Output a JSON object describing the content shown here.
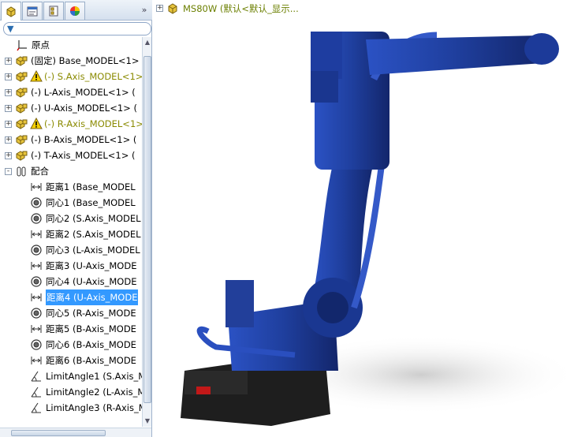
{
  "tabs": [
    {
      "name": "feature-manager-icon"
    },
    {
      "name": "property-manager-icon"
    },
    {
      "name": "configuration-manager-icon"
    },
    {
      "name": "display-manager-icon"
    }
  ],
  "tab_more": "»",
  "filter": {
    "icon": "filter-icon",
    "glyph": "▼"
  },
  "tree": [
    {
      "label": "原点",
      "icon": "origin-icon",
      "kind": "origin",
      "level": 1,
      "expander": ""
    },
    {
      "label": "(固定) Base_MODEL<1>",
      "icon": "part-icon",
      "kind": "part",
      "level": 0,
      "expander": "+"
    },
    {
      "label": "(-) S.Axis_MODEL<1>",
      "icon": "part-icon",
      "kind": "part",
      "warn": true,
      "level": 0,
      "expander": "+"
    },
    {
      "label": "(-) L-Axis_MODEL<1> (",
      "icon": "part-icon",
      "kind": "part",
      "level": 0,
      "expander": "+"
    },
    {
      "label": "(-) U-Axis_MODEL<1> (",
      "icon": "part-icon",
      "kind": "part",
      "level": 0,
      "expander": "+"
    },
    {
      "label": "(-) R-Axis_MODEL<1>",
      "icon": "part-icon",
      "kind": "part",
      "warn": true,
      "level": 0,
      "expander": "+"
    },
    {
      "label": "(-) B-Axis_MODEL<1> (",
      "icon": "part-icon",
      "kind": "part",
      "level": 0,
      "expander": "+"
    },
    {
      "label": "(-) T-Axis_MODEL<1> (",
      "icon": "part-icon",
      "kind": "part",
      "level": 0,
      "expander": "+"
    },
    {
      "label": "配合",
      "icon": "mates-folder-icon",
      "kind": "mates",
      "level": 0,
      "expander": "-"
    },
    {
      "label": "距离1 (Base_MODEL",
      "icon": "distance-mate-icon",
      "kind": "distance",
      "level": 2,
      "expander": ""
    },
    {
      "label": "同心1 (Base_MODEL",
      "icon": "concentric-mate-icon",
      "kind": "concentric",
      "level": 2,
      "expander": ""
    },
    {
      "label": "同心2 (S.Axis_MODEL",
      "icon": "concentric-mate-icon",
      "kind": "concentric",
      "level": 2,
      "expander": ""
    },
    {
      "label": "距离2 (S.Axis_MODEL",
      "icon": "distance-mate-icon",
      "kind": "distance",
      "level": 2,
      "expander": ""
    },
    {
      "label": "同心3 (L-Axis_MODEL",
      "icon": "concentric-mate-icon",
      "kind": "concentric",
      "level": 2,
      "expander": ""
    },
    {
      "label": "距离3 (U-Axis_MODE",
      "icon": "distance-mate-icon",
      "kind": "distance",
      "level": 2,
      "expander": ""
    },
    {
      "label": "同心4 (U-Axis_MODE",
      "icon": "concentric-mate-icon",
      "kind": "concentric",
      "level": 2,
      "expander": ""
    },
    {
      "label": "距离4 (U-Axis_MODE",
      "icon": "distance-mate-icon",
      "kind": "distance",
      "level": 2,
      "expander": "",
      "selected": true
    },
    {
      "label": "同心5 (R-Axis_MODE",
      "icon": "concentric-mate-icon",
      "kind": "concentric",
      "level": 2,
      "expander": ""
    },
    {
      "label": "距离5 (B-Axis_MODE",
      "icon": "distance-mate-icon",
      "kind": "distance",
      "level": 2,
      "expander": ""
    },
    {
      "label": "同心6 (B-Axis_MODE",
      "icon": "concentric-mate-icon",
      "kind": "concentric",
      "level": 2,
      "expander": ""
    },
    {
      "label": "距离6 (B-Axis_MODE",
      "icon": "distance-mate-icon",
      "kind": "distance",
      "level": 2,
      "expander": ""
    },
    {
      "label": "LimitAngle1 (S.Axis_M",
      "icon": "limit-angle-mate-icon",
      "kind": "angle",
      "level": 2,
      "expander": ""
    },
    {
      "label": "LimitAngle2 (L-Axis_M",
      "icon": "limit-angle-mate-icon",
      "kind": "angle",
      "level": 2,
      "expander": ""
    },
    {
      "label": "LimitAngle3 (R-Axis_M",
      "icon": "limit-angle-mate-icon",
      "kind": "angle",
      "level": 2,
      "expander": ""
    }
  ],
  "viewport": {
    "title": "MS80W  (默认<默认_显示...",
    "title_expander": "+",
    "title_icon": "assembly-icon",
    "model_color": "#1f3f9e"
  },
  "colors": {
    "accent": "#3399ff",
    "warning_text": "#8a8a00",
    "title_text": "#6b7f00",
    "robot_blue": "#1f3f9e",
    "robot_dark": "#13266b",
    "base_black": "#1e1e1e"
  }
}
